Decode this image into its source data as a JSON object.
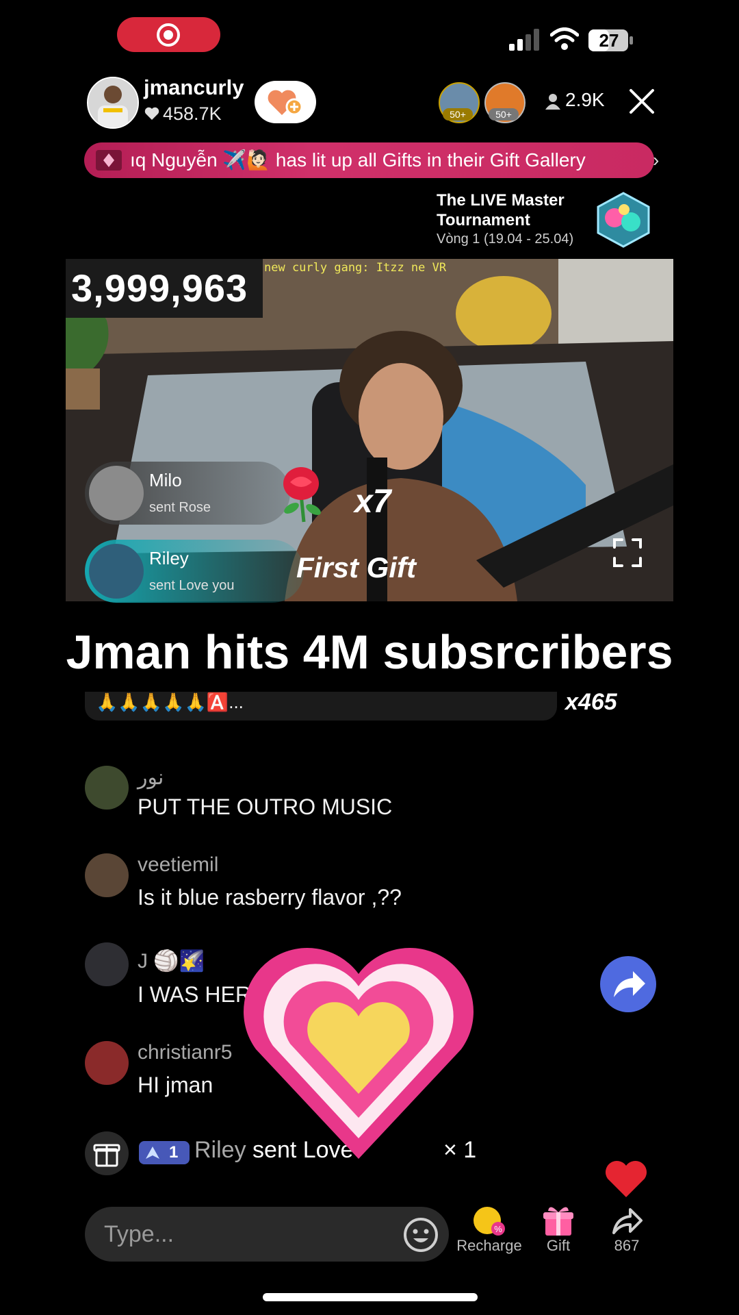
{
  "status_bar": {
    "battery": "27"
  },
  "host": {
    "name": "jmancurly",
    "likes": "458.7K"
  },
  "viewers": {
    "top_badges": [
      "50+",
      "50+"
    ],
    "count": "2.9K"
  },
  "banner": {
    "text": "ıq Nguyễn ✈️🙋🏻 has lit up all Gifts in their Gift Gallery"
  },
  "tournament": {
    "title": "The LIVE Master Tournament",
    "subtitle": "Vòng 1 (19.04 - 25.04)"
  },
  "video": {
    "counter": "3,999,963",
    "overlay_note": "new curly gang: Itzz ne VR",
    "gift_notifications": [
      {
        "name": "Milo",
        "action": "sent Rose",
        "multiplier": "x7"
      },
      {
        "name": "Riley",
        "action": "sent Love you",
        "tag": "First Gift"
      }
    ]
  },
  "caption": "Jman hits 4M subsrcribers",
  "pinned": {
    "emoji": "🙏🙏🙏🙏🙏🅰️...",
    "multiplier": "x465"
  },
  "chat": [
    {
      "user": "نور",
      "message": "PUT THE OUTRO MUSIC"
    },
    {
      "user": "veetiemil",
      "message": "Is it blue rasberry flavor ,??"
    },
    {
      "user": "J 🏐🌠",
      "message": "I WAS HER"
    },
    {
      "user": "christianr5",
      "message": "HI jman"
    }
  ],
  "gift_event": {
    "level": "1",
    "user": "Riley",
    "text": "sent Love",
    "count": "× 1"
  },
  "input": {
    "placeholder": "Type..."
  },
  "bottom_actions": {
    "recharge": "Recharge",
    "gift": "Gift",
    "share_count": "867"
  },
  "colors": {
    "banner": "#c92a62",
    "share_button": "#4f6ae0",
    "rec": "#d8283b",
    "gift_pill_teal": "#15a7b0"
  }
}
